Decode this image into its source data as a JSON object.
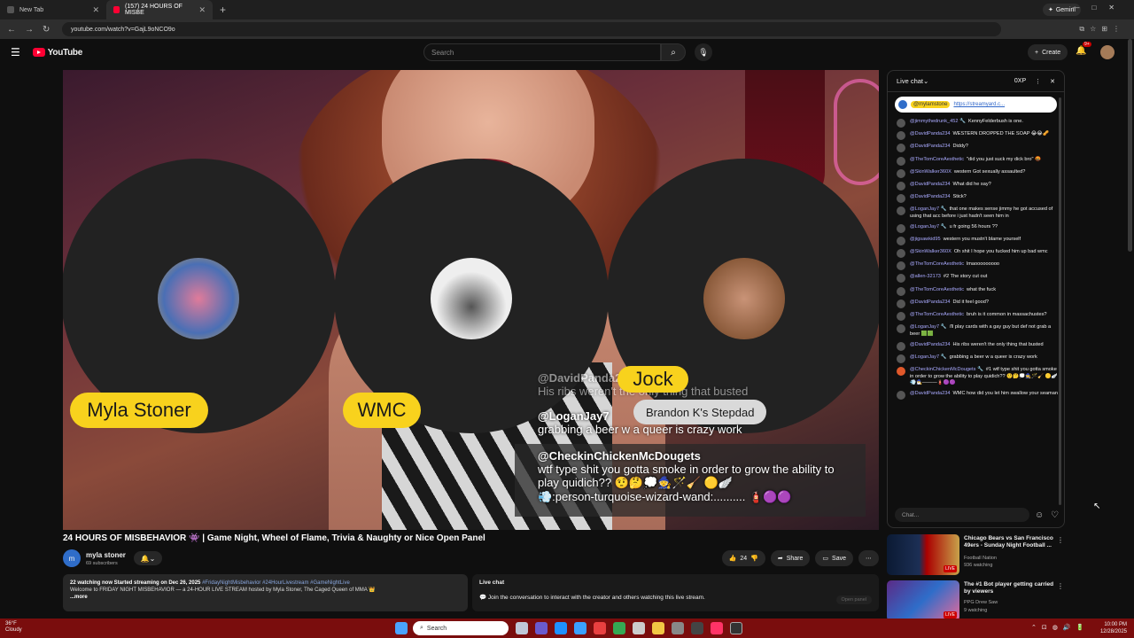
{
  "browser": {
    "tabs": [
      {
        "title": "New Tab"
      },
      {
        "title": "(157) 24 HOURS OF MISBE"
      }
    ],
    "gemini_label": "Gemini",
    "url": "youtube.com/watch?v=GajL9oNCO9o"
  },
  "header": {
    "logo": "YouTube",
    "search_placeholder": "Search",
    "create_label": "Create",
    "notifications_badge": "9+"
  },
  "video": {
    "participants": [
      {
        "name": "Myla Stoner"
      },
      {
        "name": "WMC"
      },
      {
        "name": "Jock"
      }
    ],
    "secondary_label": "Brandon K's Stepdad",
    "overlay_messages": [
      {
        "user": "@DavidPanda234",
        "text": "His ribs weren't the only thing that busted"
      },
      {
        "user": "@LoganJay7",
        "text": "grabbing a beer w a queer is crazy work"
      },
      {
        "user": "@CheckinChickenMcDougets",
        "text": "wtf type shit you gotta smoke in order to grow the ability to play quidich?? 🤨🤔💭🧙🪄🧹 🟡🪽",
        "extra": "💨:person-turquoise-wizard-wand:.......... 🧯🟣🟣"
      }
    ]
  },
  "meta": {
    "title": "24 HOURS OF MISBEHAVIOR 👾 | Game Night, Wheel of Flame, Trivia & Naughty or Nice Open Panel",
    "channel_name": "myla stoner",
    "subscribers": "69 subscribers",
    "channel_initial": "m",
    "like_count": "24",
    "share_label": "Share",
    "save_label": "Save"
  },
  "description": {
    "stats": "22 watching now  Started streaming on Dec 26, 2025",
    "tags": "#FridayNightMisbehavior #24HourLivestream #GameNightLive",
    "text": "Welcome to FRIDAY NIGHT MISBEHAVIOR — a 24-HOUR LIVE STREAM hosted by Myla Stoner, The Caged Queen of MMA 👑",
    "more": "...more"
  },
  "live_card": {
    "title": "Live chat",
    "text": "Join the conversation to interact with the creator and others watching this live stream.",
    "button": "Open panel"
  },
  "chat": {
    "title": "Live chat",
    "xp": "0XP",
    "pinned_user": "@mylamstone",
    "pinned_link": "https://streamyard.c...",
    "input_placeholder": "Chat...",
    "messages": [
      {
        "user": "@jimmythedrunk_452 🔧",
        "text": "KennyFelderbush is one."
      },
      {
        "user": "@DavidPanda234",
        "text": "WESTERN DROPPED THE SOAP 😂😂🥜"
      },
      {
        "user": "@DavidPanda234",
        "text": "Diddy?"
      },
      {
        "user": "@TheTomCoreAesthetic",
        "text": "\"did you just suck my dick bro\" 🤬"
      },
      {
        "user": "@SkinWalker360X",
        "text": "western Got sexually assaulted?"
      },
      {
        "user": "@DavidPanda234",
        "text": "What did he say?"
      },
      {
        "user": "@DavidPanda234",
        "text": "Stick?"
      },
      {
        "user": "@LoganJay7 🔧",
        "text": "that one makes sense jimmy he got accused of using that acc before i just hadn't seen him in"
      },
      {
        "user": "@LoganJay7 🔧",
        "text": "u fr going 56 hours ??"
      },
      {
        "user": "@jigsawkid95",
        "text": "western you mustn't blame yourself"
      },
      {
        "user": "@SkinWalker360X",
        "text": "Oh shit I hope you fucked him up bad wmc"
      },
      {
        "user": "@TheTomCoreAesthetic",
        "text": "lmaooooooooo"
      },
      {
        "user": "@allen-32173",
        "text": "#2  The story cut out"
      },
      {
        "user": "@TheTomCoreAesthetic",
        "text": "what the fuck"
      },
      {
        "user": "@DavidPanda234",
        "text": "Did it feel good?"
      },
      {
        "user": "@TheTomCoreAesthetic",
        "text": "bruh is it common in massachustes?"
      },
      {
        "user": "@LoganJay7 🔧",
        "text": "i'll play cards with a gay guy but def not grab a beer 🟩🟩"
      },
      {
        "user": "@DavidPanda234",
        "text": "His ribs weren't the only thing that busted"
      },
      {
        "user": "@LoganJay7 🔧",
        "text": "grabbing a beer w a queer is crazy work"
      },
      {
        "user": "@CheckinChickenMcDougets 🔧",
        "text": "#1 wtf type shit you gotta smoke in order to grow the ability to play quidich?? 🤨🤔💭🧙🪄🧹 🟡🪽💨🧙‍♂️———🧯🟣🟣"
      },
      {
        "user": "@DavidPanda234",
        "text": "WMC how did you let him swallow your seaman"
      }
    ]
  },
  "recommendations": [
    {
      "title": "Chicago Bears vs San Francisco 49ers - Sunday Night Football ...",
      "channel": "Football Nation",
      "views": "936 watching",
      "badge": "LIVE"
    },
    {
      "title": "The #1 Bot player getting carried by viewers",
      "channel": "PPG Drew Saw",
      "views": "9 watching",
      "badge": "LIVE"
    }
  ],
  "taskbar": {
    "weather_temp": "36°F",
    "weather_desc": "Cloudy",
    "search_label": "Search",
    "time": "10:00 PM",
    "date": "12/28/2025"
  },
  "colors": {
    "accent": "#ff0033",
    "name_pill": "#f8d21d",
    "taskbar": "#7a0d0d"
  }
}
